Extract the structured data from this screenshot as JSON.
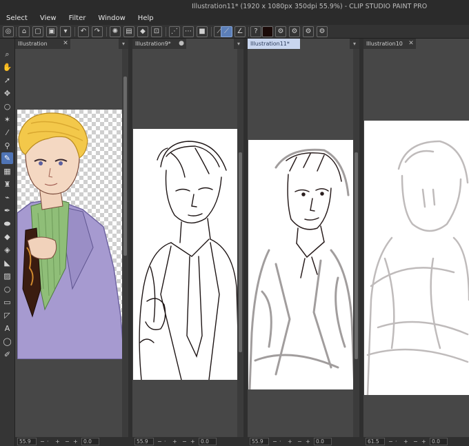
{
  "window": {
    "title": "Illustration11* (1920 x 1080px 350dpi 55.9%) - CLIP STUDIO PAINT PRO"
  },
  "menu": [
    "Select",
    "View",
    "Filter",
    "Window",
    "Help"
  ],
  "toolbar_icons": [
    "zoom-icon",
    "hand-icon",
    "operation-icon",
    "move-icon",
    "lasso-icon",
    "magic-wand-icon",
    "eyedropper-icon",
    "pen-icon",
    "pencil-icon",
    "brush-icon",
    "airbrush-icon",
    "decoration-icon",
    "eraser-icon",
    "blend-icon",
    "fill-icon",
    "gradient-icon",
    "figure-icon",
    "frame-icon",
    "ruler-icon",
    "text-icon",
    "balloon-icon",
    "correct-line-icon"
  ],
  "colors": {
    "accent": "#4f74b5",
    "main_color": "#1a0a08",
    "sub_color": "#ffffff"
  },
  "panels": [
    {
      "tab": "Illustration",
      "zoom": "55.9",
      "angle": "0.0",
      "active": false,
      "modified": false
    },
    {
      "tab": "Illustration9*",
      "zoom": "55.9",
      "angle": "0.0",
      "active": false,
      "modified": true
    },
    {
      "tab": "Illustration11*",
      "zoom": "55.9",
      "angle": "0.0",
      "active": true,
      "modified": true
    },
    {
      "tab": "Illustration10",
      "zoom": "61.5",
      "angle": "0.0",
      "active": false,
      "modified": false
    }
  ]
}
